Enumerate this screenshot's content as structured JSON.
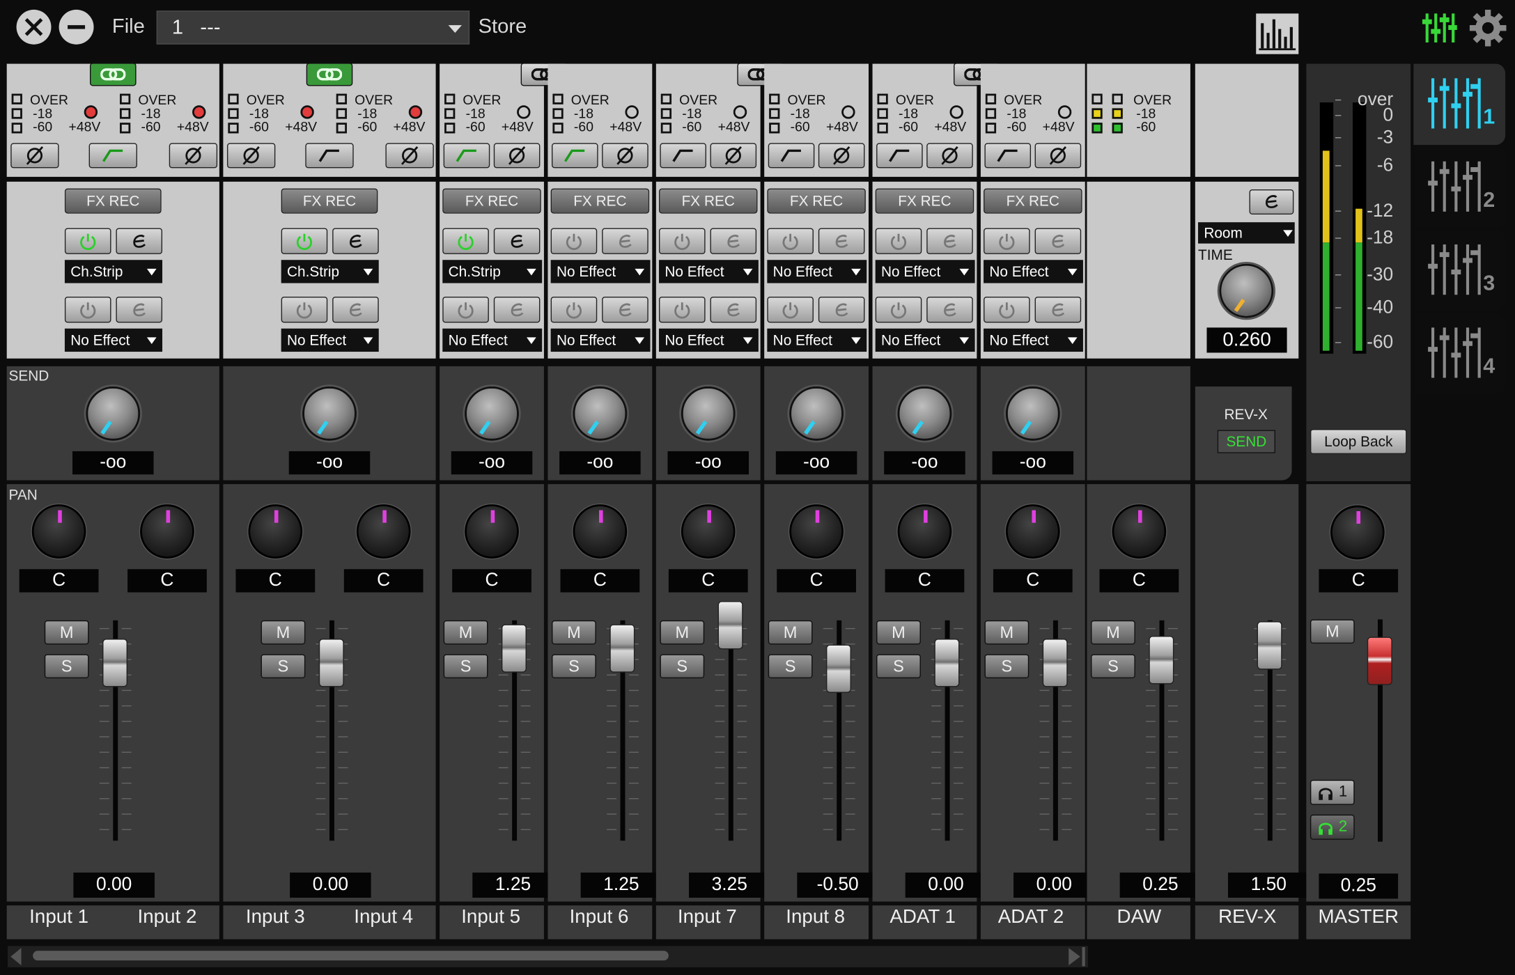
{
  "topbar": {
    "file_label": "File",
    "preset_value": "1   ---",
    "store_label": "Store"
  },
  "meter_labels": {
    "over": "OVER",
    "m18": "-18",
    "m60": "-60",
    "phantom": "+48V"
  },
  "sections": {
    "send": "SEND",
    "pan": "PAN"
  },
  "fx_rec_label": "FX REC",
  "channels": [
    {
      "name": "Input 1",
      "pan": "C",
      "send": "-oo",
      "volume": "0.00",
      "effect1": "Ch.Strip",
      "effect2": "No Effect"
    },
    {
      "name": "Input 2",
      "pan": "C"
    },
    {
      "name": "Input 3",
      "pan": "C",
      "send": "-oo",
      "volume": "0.00",
      "effect1": "Ch.Strip",
      "effect2": "No Effect"
    },
    {
      "name": "Input 4",
      "pan": "C"
    },
    {
      "name": "Input 5",
      "pan": "C",
      "send": "-oo",
      "volume": "1.25",
      "effect1": "Ch.Strip",
      "effect2": "No Effect"
    },
    {
      "name": "Input 6",
      "pan": "C",
      "send": "-oo",
      "volume": "1.25",
      "effect1": "No Effect",
      "effect2": "No Effect"
    },
    {
      "name": "Input 7",
      "pan": "C",
      "send": "-oo",
      "volume": "3.25",
      "effect1": "No Effect",
      "effect2": "No Effect"
    },
    {
      "name": "Input 8",
      "pan": "C",
      "send": "-oo",
      "volume": "-0.50",
      "effect1": "No Effect",
      "effect2": "No Effect"
    },
    {
      "name": "ADAT 1",
      "pan": "C",
      "send": "-oo",
      "volume": "0.00",
      "effect1": "No Effect",
      "effect2": "No Effect"
    },
    {
      "name": "ADAT 2",
      "pan": "C",
      "send": "-oo",
      "volume": "0.00",
      "effect1": "No Effect",
      "effect2": "No Effect"
    },
    {
      "name": "DAW",
      "pan": "C",
      "volume": "0.25"
    },
    {
      "name": "REV-X",
      "volume": "1.50"
    },
    {
      "name": "MASTER",
      "pan": "C",
      "volume": "0.25"
    }
  ],
  "buttons": {
    "mute": "M",
    "solo": "S",
    "loop_back": "Loop Back"
  },
  "reverb": {
    "type": "Room",
    "time_label": "TIME",
    "time_value": "0.260",
    "revx_label": "REV-X",
    "send_label": "SEND"
  },
  "master_scale": [
    "over",
    "0",
    "-3",
    "-6",
    "-12",
    "-18",
    "-30",
    "-40",
    "-60"
  ],
  "phones": [
    "1",
    "2"
  ],
  "mixer_tabs": [
    "1",
    "2",
    "3",
    "4"
  ],
  "colors": {
    "accent_cyan": "#2fd0f0",
    "pan_pointer": "#e040e0",
    "power_green": "#35d035",
    "master_fader_red": "#c83030",
    "time_pointer": "#f0b030"
  }
}
